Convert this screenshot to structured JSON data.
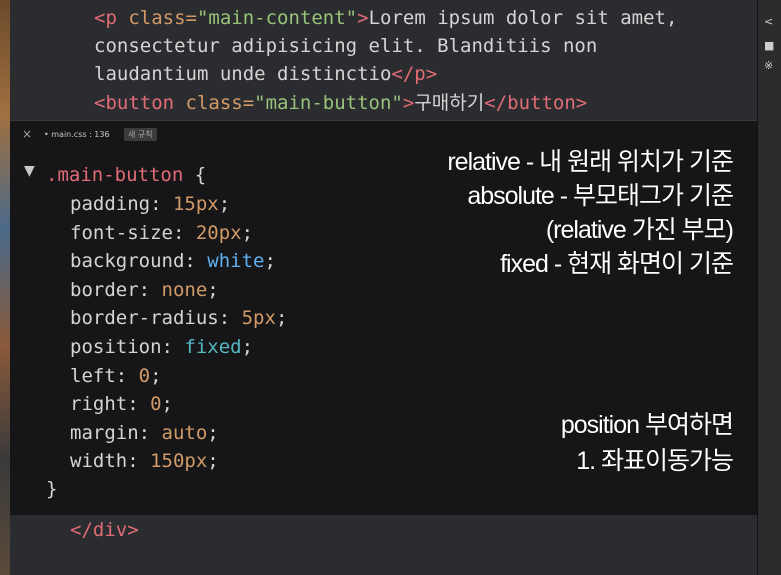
{
  "top_code": {
    "line1": {
      "open_tag_start": "<p",
      "attr": " class=",
      "value": "\"main-content\"",
      "close": ">",
      "text": "Lorem ipsum dolor sit amet,"
    },
    "line2": {
      "text": "consectetur adipisicing elit. Blanditiis non"
    },
    "line3": {
      "text": "laudantium unde distinctio",
      "end_tag": "</p>"
    },
    "line4": {
      "open_tag_start": "<button",
      "attr": " class=",
      "value": "\"main-button\"",
      "close": ">",
      "text": "구매하기",
      "end_tag": "</button>"
    }
  },
  "inline_editor": {
    "close_icon": "×",
    "file_label": "• main.css : 136",
    "new_rule_label": "새 규칙",
    "collapse_icon": "▼",
    "selector": ".main-button",
    "open_brace": " {",
    "close_brace": "}",
    "declarations": [
      {
        "prop": "padding",
        "value": "15px",
        "kind": "num"
      },
      {
        "prop": "font-size",
        "value": "20px",
        "kind": "num"
      },
      {
        "prop": "background",
        "value": "white",
        "kind": "name"
      },
      {
        "prop": "border",
        "value": "none",
        "kind": "num"
      },
      {
        "prop": "border-radius",
        "value": "5px",
        "kind": "num"
      },
      {
        "prop": "position",
        "value": "fixed",
        "kind": "kw"
      },
      {
        "prop": "left",
        "value": "0",
        "kind": "num"
      },
      {
        "prop": "right",
        "value": "0",
        "kind": "num"
      },
      {
        "prop": "margin",
        "value": "auto",
        "kind": "num"
      },
      {
        "prop": "width",
        "value": "150px",
        "kind": "num"
      }
    ]
  },
  "annotations": {
    "relative": "relative - 내 원래 위치가 기준",
    "absolute": "absolute - 부모태그가 기준",
    "relative_parent": "(relative 가진 부모)",
    "fixed": "fixed - 현재 화면이 기준",
    "position_intro": "position 부여하면",
    "position_point1": "1. 좌표이동가능"
  },
  "bottom_code": {
    "end_div": "</div>"
  },
  "right_panel": {
    "glyph1": "<",
    "glyph2": "■",
    "glyph3": "※"
  },
  "colors": {
    "tag": "#e06c75",
    "attr": "#d19a66",
    "string": "#98c379",
    "keyword": "#56b6c2"
  }
}
